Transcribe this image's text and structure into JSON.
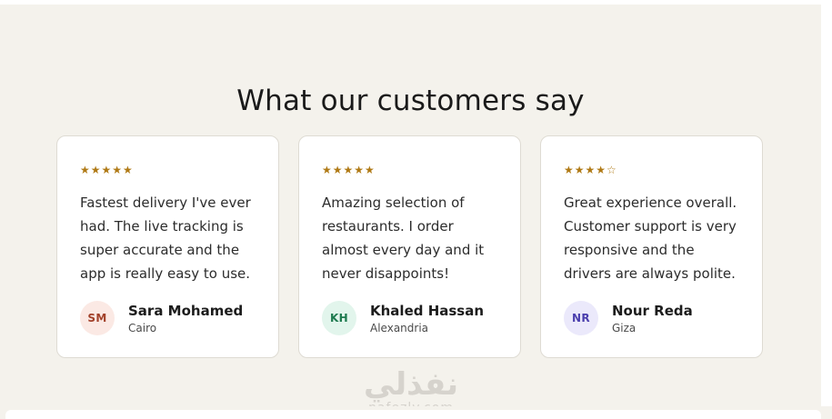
{
  "section": {
    "title": "What our customers say"
  },
  "testimonials": [
    {
      "stars": "★★★★★",
      "rating": 5,
      "text": "Fastest delivery I've ever had. The live tracking is super accurate and the app is really easy to use.",
      "initials": "SM",
      "name": "Sara Mohamed",
      "city": "Cairo",
      "avatar_bg": "#fbe9e4",
      "avatar_fg": "#a2412a"
    },
    {
      "stars": "★★★★★",
      "rating": 5,
      "text": "Amazing selection of restaurants. I order almost every day and it never disappoints!",
      "initials": "KH",
      "name": "Khaled Hassan",
      "city": "Alexandria",
      "avatar_bg": "#e2f5ec",
      "avatar_fg": "#1e7a4f"
    },
    {
      "stars": "★★★★☆",
      "rating": 4,
      "text": "Great experience overall. Customer support is very responsive and the drivers are always polite.",
      "initials": "NR",
      "name": "Nour Reda",
      "city": "Giza",
      "avatar_bg": "#ebe9fb",
      "avatar_fg": "#4b3fae"
    }
  ],
  "watermark": {
    "arabic": "نفذلي",
    "latin": "nafezly.com"
  },
  "colors": {
    "section_bg": "#f4f2ec",
    "star": "#b07a16",
    "card_border": "#dedbd3"
  }
}
